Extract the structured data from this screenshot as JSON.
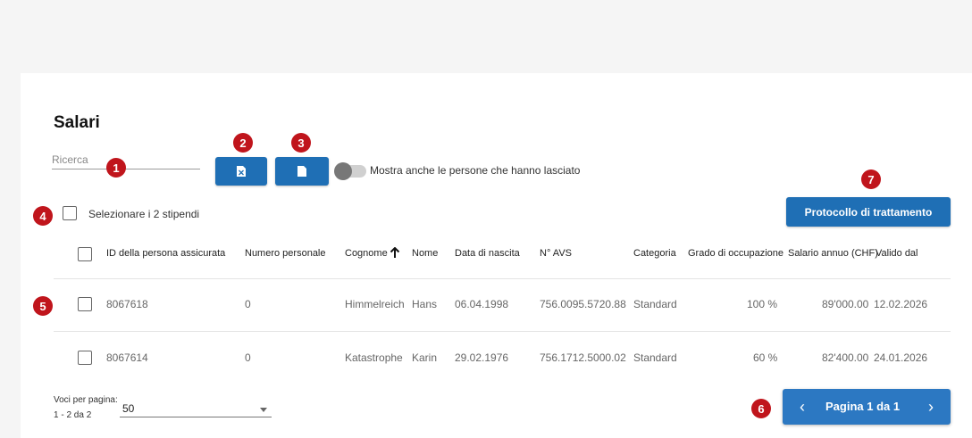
{
  "page": {
    "title": "Salari"
  },
  "search": {
    "placeholder": "Ricerca",
    "value": ""
  },
  "toolbar": {
    "excel_icon": "excel-file-icon",
    "document_icon": "document-file-icon"
  },
  "toggle": {
    "label": "Mostra anche le persone che hanno lasciato",
    "checked": false
  },
  "select_all": {
    "label": "Selezionare i 2 stipendi"
  },
  "protocol_button": {
    "label": "Protocollo di trattamento"
  },
  "markers": [
    "1",
    "2",
    "3",
    "4",
    "5",
    "6",
    "7"
  ],
  "table": {
    "columns": [
      "ID della persona assicurata",
      "Numero personale",
      "Cognome",
      "Nome",
      "Data di nascita",
      "N° AVS",
      "Categoria",
      "Grado di occupazione",
      "Salario annuo (CHF)",
      "Valido dal"
    ],
    "sort_icon": "arrow-up-icon",
    "rows": [
      [
        "8067618",
        "0",
        "Himmelreich",
        "Hans",
        "06.04.1998",
        "756.0095.5720.88",
        "Standard",
        "100 %",
        "89'000.00",
        "12.02.2026"
      ],
      [
        "8067614",
        "0",
        "Katastrophe",
        "Karin",
        "29.02.1976",
        "756.1712.5000.02",
        "Standard",
        "60 %",
        "82'400.00",
        "24.01.2026"
      ]
    ]
  },
  "pagination": {
    "per_page_label": "Voci per pagina:",
    "range_label": "1 - 2 da 2",
    "per_page_value": "50",
    "page_label": "Pagina 1 da 1",
    "prev": "‹",
    "next": "›"
  },
  "colors": {
    "primary": "#1f6fb5",
    "marker": "#c0151c"
  }
}
